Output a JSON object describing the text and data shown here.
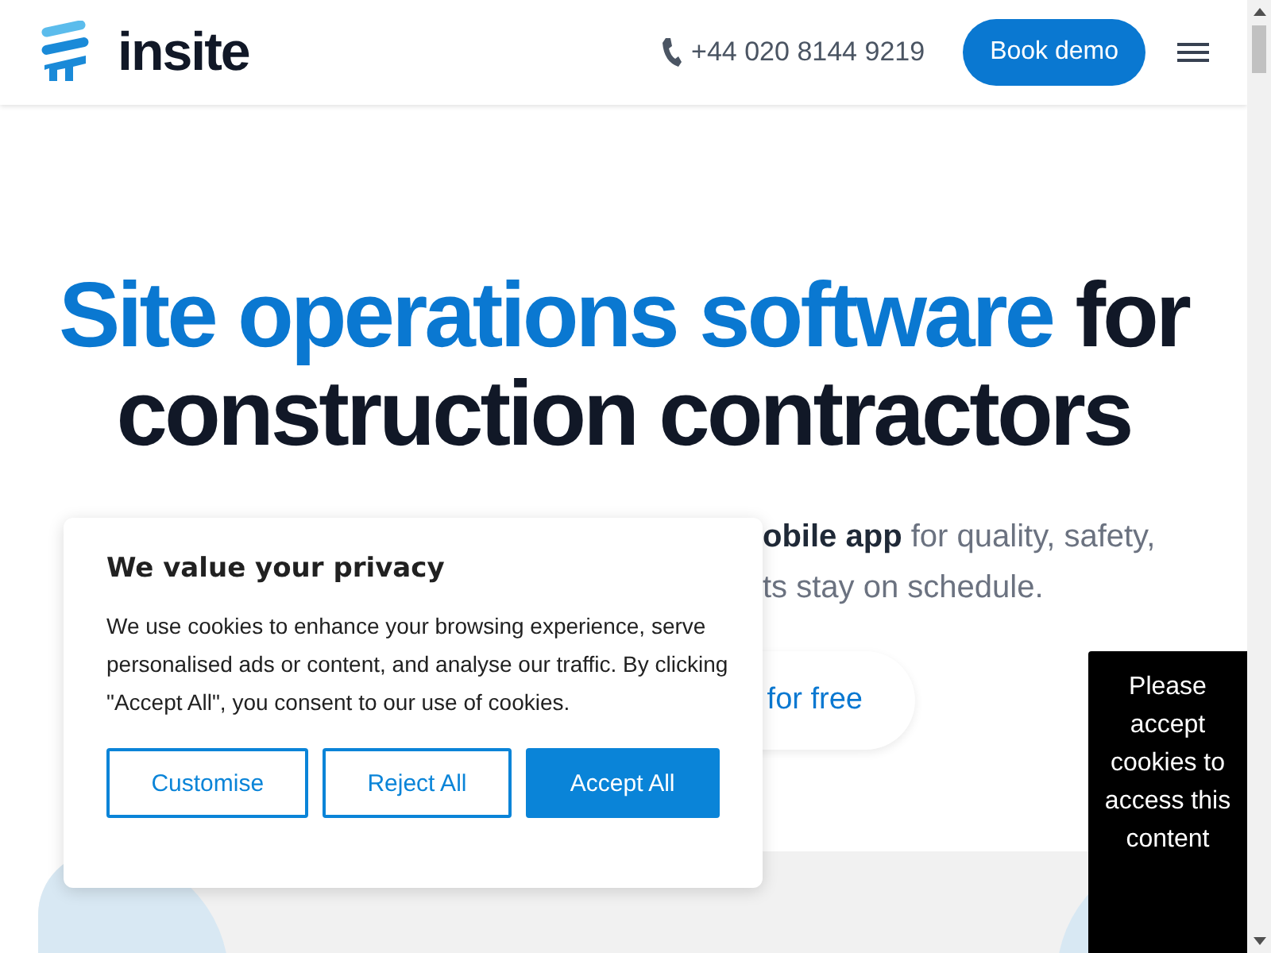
{
  "header": {
    "logo_text": "insite",
    "phone": "+44 020 8144 9219",
    "cta": "Book demo"
  },
  "hero": {
    "headline_highlight": "Site operations software",
    "headline_rest": "for construction contractors",
    "subtitle_lines": [
      "**obile app** for quality, safety,",
      "ts stay on schedule."
    ],
    "cta": "for free"
  },
  "cookie_dialog": {
    "title": "We value your privacy",
    "body": "We use cookies to enhance your browsing experience, serve personalised ads or content, and analyse our traffic. By clicking \"Accept All\", you consent to our use of cookies.",
    "buttons": [
      {
        "label": "Customise",
        "kind": "outline"
      },
      {
        "label": "Reject All",
        "kind": "outline"
      },
      {
        "label": "Accept All",
        "kind": "primary"
      }
    ]
  },
  "blocked_notice": "Please accept cookies to access this content"
}
